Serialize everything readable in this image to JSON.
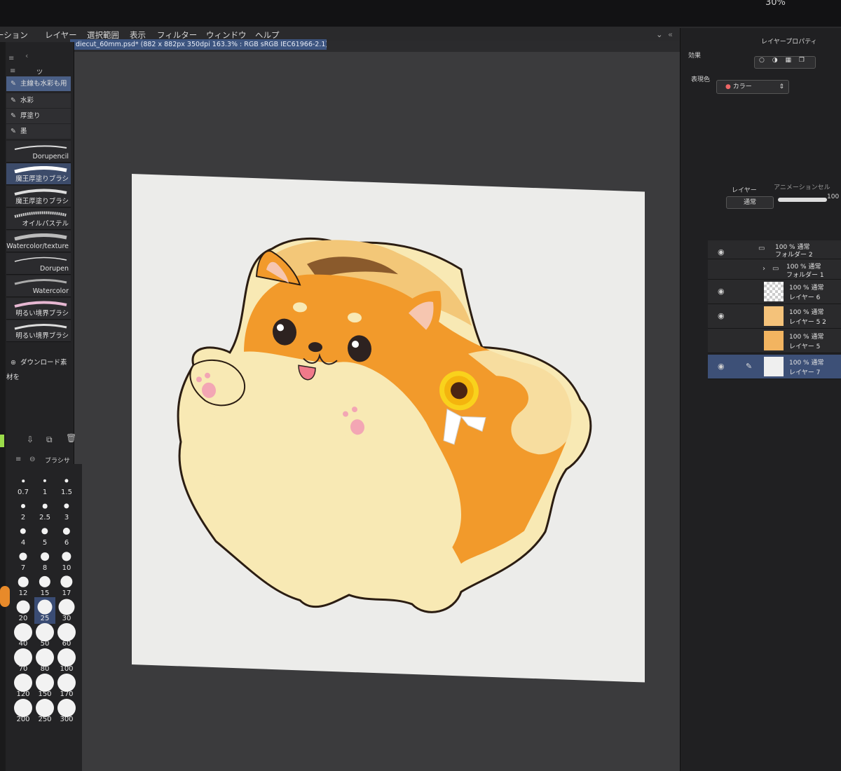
{
  "status": {
    "battery": "30%"
  },
  "menubar": [
    "ーション",
    "レイヤー",
    "選択範囲",
    "表示",
    "フィルター",
    "ウィンドウ",
    "ヘルプ"
  ],
  "document_tab": "diecut_60mm.psd* (882 x 882px 350dpi 163.3% : RGB sRGB IEC61966-2.1)",
  "subtool_panel": {
    "tab_label": "ツ",
    "groups": [
      "主線も水彩も用",
      "水彩",
      "厚塗り",
      "墨"
    ],
    "brushes": [
      "Dorupencil",
      "魔王厚塗りブラシ",
      "魔王厚塗りブラシ",
      "オイルパステル",
      "Watercolor/texture",
      "Dorupen",
      "Watercolor",
      "明るい境界ブラシ",
      "明るい境界ブラシ"
    ],
    "download_label": "ダウンロード素材を"
  },
  "brush_size": {
    "tab_label": "ブラシサ",
    "sizes": [
      "0.7",
      "1",
      "1.5",
      "2",
      "2.5",
      "3",
      "4",
      "5",
      "6",
      "7",
      "8",
      "10",
      "12",
      "15",
      "17",
      "20",
      "25",
      "30",
      "40",
      "50",
      "60",
      "70",
      "80",
      "100",
      "120",
      "150",
      "170",
      "200",
      "250",
      "300"
    ],
    "selected": "25"
  },
  "layer_property": {
    "tab_label": "レイヤープロパティ",
    "effect_label": "効果",
    "expression_color_label": "表現色",
    "expression_color_value": "カラー"
  },
  "layers_panel": {
    "tab_label": "レイヤー",
    "tab2_label": "アニメーションセル",
    "blend_mode": "通常",
    "opacity": "100",
    "layers": [
      {
        "opacity_mode": "100 % 通常",
        "name": "フォルダー 2"
      },
      {
        "opacity_mode": "100 % 通常",
        "name": "フォルダー 1"
      },
      {
        "opacity_mode": "100 % 通常",
        "name": "レイヤー 6"
      },
      {
        "opacity_mode": "100 % 通常",
        "name": "レイヤー 5 2"
      },
      {
        "opacity_mode": "100 % 通常",
        "name": "レイヤー 5"
      },
      {
        "opacity_mode": "100 % 通常",
        "name": "レイヤー 7"
      }
    ]
  },
  "colors": {
    "accent": "#3d5580",
    "fur_orange": "#f29a2b",
    "cream": "#f8e9b4",
    "canvas": "#ececea"
  }
}
